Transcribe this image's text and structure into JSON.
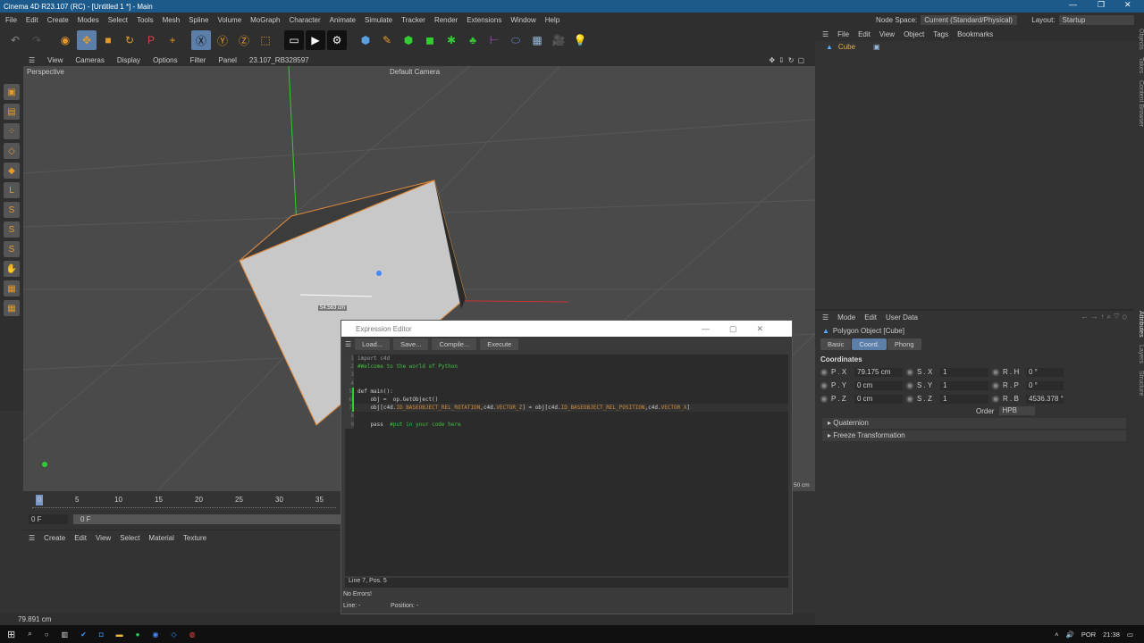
{
  "window": {
    "title": "Cinema 4D R23.107 (RC) - [Untitled 1 *] - Main",
    "minimize": "—",
    "maximize": "❐",
    "close": "✕"
  },
  "menu": [
    "File",
    "Edit",
    "Create",
    "Modes",
    "Select",
    "Tools",
    "Mesh",
    "Spline",
    "Volume",
    "MoGraph",
    "Character",
    "Animate",
    "Simulate",
    "Tracker",
    "Render",
    "Extensions",
    "Window",
    "Help"
  ],
  "nodespace": {
    "label": "Node Space:",
    "value": "Current (Standard/Physical)"
  },
  "layout": {
    "label": "Layout:",
    "value": "Startup"
  },
  "viewport": {
    "menu": [
      "View",
      "Cameras",
      "Display",
      "Options",
      "Filter",
      "Panel"
    ],
    "build": "23.107_RB328597",
    "name": "Perspective",
    "camera": "Default Camera",
    "measure": "54.563 cm",
    "grid_info": "50 cm"
  },
  "timeline": {
    "ticks": [
      "0",
      "5",
      "10",
      "15",
      "20",
      "25",
      "30",
      "35"
    ],
    "current_frame": "0 F",
    "range_start": "0 F"
  },
  "material_manager": {
    "menu": [
      "Create",
      "Edit",
      "View",
      "Select",
      "Material",
      "Texture"
    ]
  },
  "status": {
    "text": "79.891 cm"
  },
  "objects": {
    "menu": [
      "File",
      "Edit",
      "View",
      "Object",
      "Tags",
      "Bookmarks"
    ],
    "items": [
      {
        "name": "Cube"
      }
    ],
    "side_tabs": [
      "Objects",
      "Takes",
      "Content Browser"
    ]
  },
  "attributes": {
    "menu": [
      "Mode",
      "Edit",
      "User Data"
    ],
    "object_title": "Polygon Object [Cube]",
    "tabs": [
      "Basic",
      "Coord.",
      "Phong"
    ],
    "active_tab": "Coord.",
    "section": "Coordinates",
    "rows": [
      {
        "p_label": "P . X",
        "p": "79.175 cm",
        "s_label": "S . X",
        "s": "1",
        "r_label": "R . H",
        "r": "0 °"
      },
      {
        "p_label": "P . Y",
        "p": "0 cm",
        "s_label": "S . Y",
        "s": "1",
        "r_label": "R . P",
        "r": "0 °"
      },
      {
        "p_label": "P . Z",
        "p": "0 cm",
        "s_label": "S . Z",
        "s": "1",
        "r_label": "R . B",
        "r": "4536.378 °"
      }
    ],
    "order_label": "Order",
    "order": "HPB",
    "folds": [
      "Quaternion",
      "Freeze Transformation"
    ],
    "side_tabs": [
      "Attributes",
      "Layers",
      "Structure"
    ]
  },
  "expression_editor": {
    "title": "Expression Editor",
    "buttons": [
      "Load...",
      "Save...",
      "Compile...",
      "Execute"
    ],
    "code": [
      {
        "n": "1",
        "parts": [
          [
            "kw",
            "import c4d"
          ]
        ]
      },
      {
        "n": "2",
        "parts": [
          [
            "cm",
            "#Welcome to the world of Python"
          ]
        ]
      },
      {
        "n": "3",
        "parts": []
      },
      {
        "n": "4",
        "parts": []
      },
      {
        "n": "5",
        "parts": [
          [
            "tx",
            "def main():"
          ]
        ]
      },
      {
        "n": "6",
        "parts": [
          [
            "tx",
            "    obj =  op.GetObject()"
          ]
        ]
      },
      {
        "n": "7",
        "parts": [
          [
            "tx",
            "    obj[c4d."
          ],
          [
            "cn",
            "ID_BASEOBJECT_REL_ROTATION"
          ],
          [
            "tx",
            ",c4d."
          ],
          [
            "cn",
            "VECTOR_Z"
          ],
          [
            "tx",
            "] = obj[c4d."
          ],
          [
            "cn",
            "ID_BASEOBJECT_REL_POSITION"
          ],
          [
            "tx",
            ",c4d."
          ],
          [
            "cn",
            "VECTOR_X"
          ],
          [
            "tx",
            "]"
          ]
        ]
      },
      {
        "n": "8",
        "parts": []
      },
      {
        "n": "9",
        "parts": [
          [
            "tx",
            "    pass  "
          ],
          [
            "cm",
            "#put in your code here"
          ]
        ]
      }
    ],
    "cursor": "Line 7, Pos. 5",
    "errors": "No Errors!",
    "line_label": "Line:  -",
    "position_label": "Position:  -"
  },
  "taskbar": {
    "lang": "POR",
    "time": "21:38"
  }
}
